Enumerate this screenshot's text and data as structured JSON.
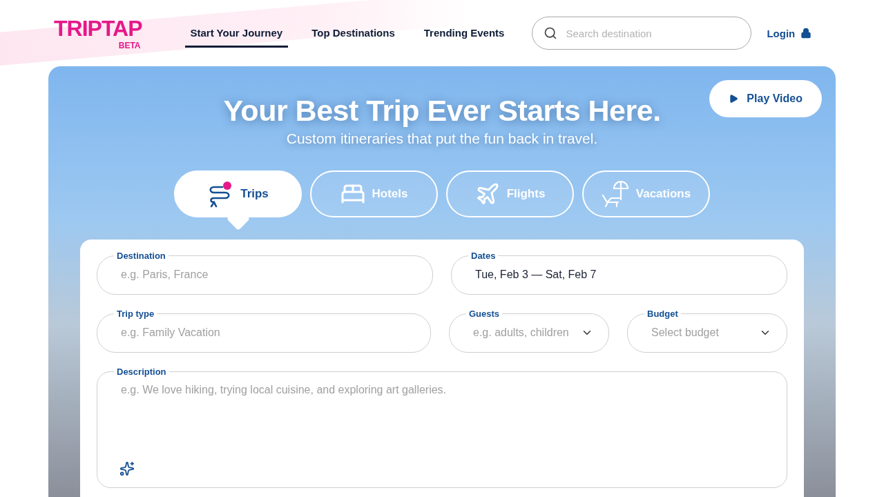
{
  "logo": {
    "name": "TRIPTAP",
    "badge": "BETA"
  },
  "nav": [
    {
      "label": "Start Your Journey",
      "selected": true
    },
    {
      "label": "Top Destinations",
      "selected": false
    },
    {
      "label": "Trending Events",
      "selected": false
    }
  ],
  "search": {
    "placeholder": "Search destination"
  },
  "login": "Login",
  "hero": {
    "play_button": "Play Video",
    "title": "Your Best Trip Ever Starts Here.",
    "subtitle": "Custom itineraries that put the fun back in travel."
  },
  "modes": [
    {
      "kind": "trips",
      "label": "Trips",
      "selected": true
    },
    {
      "kind": "hotels",
      "label": "Hotels",
      "selected": false
    },
    {
      "kind": "flights",
      "label": "Flights",
      "selected": false
    },
    {
      "kind": "vacations",
      "label": "Vacations",
      "selected": false
    }
  ],
  "form": {
    "rows": [
      [
        {
          "kind": "text",
          "label": "Destination",
          "placeholder": "e.g. Paris, France"
        },
        {
          "kind": "text",
          "label": "Dates",
          "value": "Tue, Feb 3 — Sat, Feb 7"
        }
      ],
      [
        {
          "kind": "text",
          "label": "Trip type",
          "placeholder": "e.g. Family Vacation"
        },
        {
          "kind": "select",
          "label": "Guests",
          "placeholder": "e.g. adults, children"
        },
        {
          "kind": "select",
          "label": "Budget",
          "placeholder": "Select budget"
        }
      ]
    ],
    "description": {
      "label": "Description",
      "placeholder": "e.g. We love hiking, trying local cuisine, and exploring art galleries."
    }
  }
}
